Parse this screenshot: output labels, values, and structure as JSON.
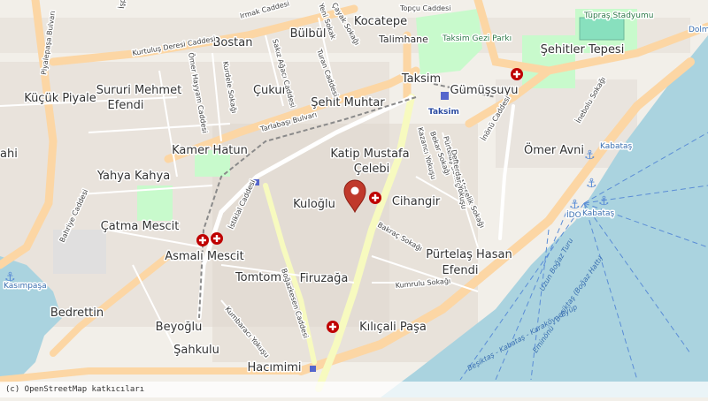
{
  "map": {
    "attribution": "(c) OpenStreetMap katkıcıları",
    "neighborhoods": [
      {
        "key": "kocatepe",
        "text": "Kocatepe"
      },
      {
        "key": "bostan",
        "text": "Bostan"
      },
      {
        "key": "bulbul",
        "text": "Bülbül"
      },
      {
        "key": "kucuk_piyale",
        "text": "Küçük Piyale"
      },
      {
        "key": "sururi1",
        "text": "Sururi Mehmet"
      },
      {
        "key": "sururi2",
        "text": "Efendi"
      },
      {
        "key": "cukur",
        "text": "Çukur"
      },
      {
        "key": "sehit_muhtar",
        "text": "Şehit Muhtar"
      },
      {
        "key": "taksim",
        "text": "Taksim"
      },
      {
        "key": "gumussuyu",
        "text": "Gümüşsuyu"
      },
      {
        "key": "sehitler_tepesi",
        "text": "Şehitler Tepesi"
      },
      {
        "key": "kamer_hatun",
        "text": "Kamer Hatun"
      },
      {
        "key": "katip1",
        "text": "Katip Mustafa"
      },
      {
        "key": "katip2",
        "text": "Çelebi"
      },
      {
        "key": "omer_avni",
        "text": "Ömer Avni"
      },
      {
        "key": "yahya_kahya",
        "text": "Yahya Kahya"
      },
      {
        "key": "kuloglu",
        "text": "Kuloğlu"
      },
      {
        "key": "cihangir",
        "text": "Cihangir"
      },
      {
        "key": "catma_mescit",
        "text": "Çatma Mescit"
      },
      {
        "key": "asmali_mescit",
        "text": "Asmalı Mescit"
      },
      {
        "key": "purtelas1",
        "text": "Pürtelaş Hasan"
      },
      {
        "key": "purtelas2",
        "text": "Efendi"
      },
      {
        "key": "tomtom",
        "text": "Tomtom"
      },
      {
        "key": "firuzaga",
        "text": "Firuzağa"
      },
      {
        "key": "bedrettin",
        "text": "Bedrettin"
      },
      {
        "key": "beyoglu",
        "text": "Beyoğlu"
      },
      {
        "key": "kilicali",
        "text": "Kılıçali Paşa"
      },
      {
        "key": "sahkulu",
        "text": "Şahkulu"
      },
      {
        "key": "hacimimi",
        "text": "Hacımimi"
      },
      {
        "key": "ahi",
        "text": "ahi"
      }
    ],
    "streets": [
      {
        "key": "piyalepasa",
        "text": "Piyalepaşa Bulvarı"
      },
      {
        "key": "kurtulus",
        "text": "Kurtuluş Deresi Caddesi"
      },
      {
        "key": "irmak",
        "text": "Irmak Caddesi"
      },
      {
        "key": "tarlabasi",
        "text": "Tarlabaşı Bulvarı"
      },
      {
        "key": "inonu",
        "text": "İnönü Caddesi"
      },
      {
        "key": "istiklal",
        "text": "İstiklal Caddesi"
      },
      {
        "key": "bahriye",
        "text": "Bahriye Caddesi"
      },
      {
        "key": "bogazkesen",
        "text": "Boğazkesen Caddesi"
      },
      {
        "key": "meselik",
        "text": "Meşelik Sokağı"
      },
      {
        "key": "bakrac",
        "text": "Bakraç Sokağı"
      },
      {
        "key": "kumrulu",
        "text": "Kumrulu Sokağı"
      },
      {
        "key": "kumbaraci",
        "text": "Kumbaracı Yokuşu"
      },
      {
        "key": "turan",
        "text": "Turan Caddesi"
      },
      {
        "key": "topcu",
        "text": "Topçu Caddesi"
      },
      {
        "key": "inebolu",
        "text": "İnebolu Sokağı"
      },
      {
        "key": "omer_hayyam",
        "text": "Ömer Hayyam Caddesi"
      },
      {
        "key": "kurdele",
        "text": "Kurdele Sokağı"
      },
      {
        "key": "sakiz",
        "text": "Sakız Ağacı Caddesi"
      },
      {
        "key": "yeni",
        "text": "Yeni Sokak"
      },
      {
        "key": "bekar",
        "text": "Bekar Sokağı"
      },
      {
        "key": "kazanci",
        "text": "Kazancı Yokuşu"
      },
      {
        "key": "pursaklar",
        "text": "Pürtelaş Sokağı"
      },
      {
        "key": "defterdar",
        "text": "Defterdar Yokuşu"
      },
      {
        "key": "cayak",
        "text": "Çayak Sokağı"
      },
      {
        "key": "ispilci",
        "text": "İşpilci Fırını"
      }
    ],
    "pois": [
      {
        "key": "taksim_park",
        "text": "Taksim Gezi Parkı"
      },
      {
        "key": "talimhane",
        "text": "Talimhane"
      },
      {
        "key": "tupras",
        "text": "Tüpraş Stadyumu"
      },
      {
        "key": "taksim_station",
        "text": "Taksim"
      },
      {
        "key": "kabatas1",
        "text": "Kabataş"
      },
      {
        "key": "kabatas2",
        "text": "Kabataş"
      },
      {
        "key": "kasimpasa",
        "text": "Kasımpaşa"
      },
      {
        "key": "ido",
        "text": "İDO"
      },
      {
        "key": "dolma",
        "text": "Dolm"
      },
      {
        "key": "ferry1",
        "text": "Beşiktaş - Kabataş - Karaköy - Eyüp"
      },
      {
        "key": "ferry2",
        "text": "Uzun Boğaz Turu"
      },
      {
        "key": "ferry3",
        "text": "Eminönü - Beşiktaş (Boğaz Hattı)"
      }
    ],
    "marker": {
      "name": "location-pin"
    },
    "colors": {
      "land": "#f2efe9",
      "water": "#aad3df",
      "primary": "#fcd6a4",
      "secondary": "#f7fabf",
      "park": "#c8facc",
      "building": "#d9d0c9",
      "hospital": "#bf0000",
      "rail": "#707070",
      "marker": "#c0392b"
    }
  }
}
